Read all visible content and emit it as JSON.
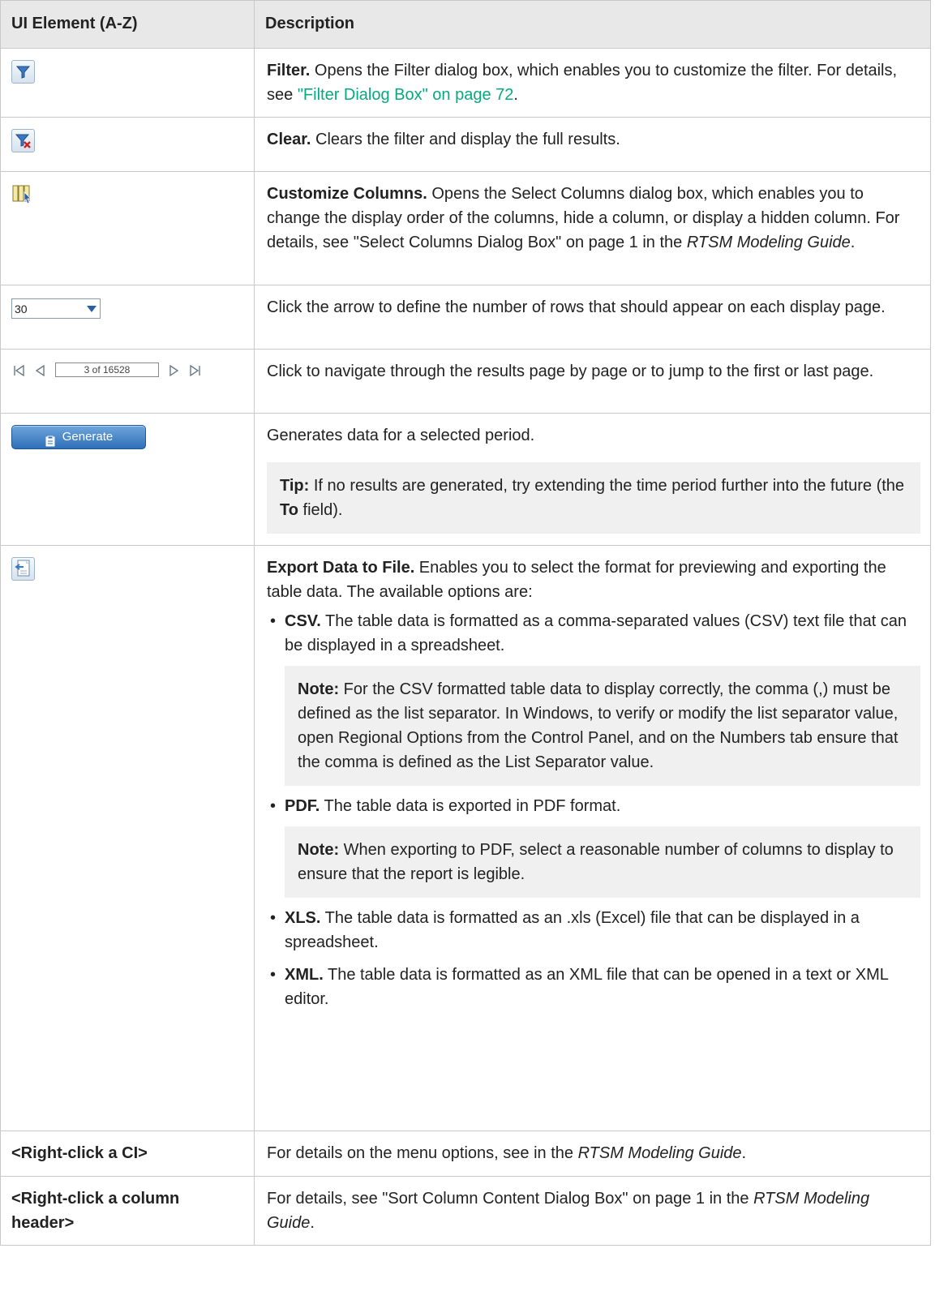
{
  "header": {
    "col1": "UI Element (A-Z)",
    "col2": "Description"
  },
  "rows": {
    "filter": {
      "icon": "filter-icon",
      "term": "Filter.",
      "text": " Opens the Filter dialog box, which enables you to customize the filter. For details, see ",
      "link": "\"Filter Dialog Box\" on page 72",
      "tail": "."
    },
    "clear": {
      "icon": "clear-filter-icon",
      "term": "Clear.",
      "text": " Clears the filter and display the full results."
    },
    "customize": {
      "icon": "customize-columns-icon",
      "term": "Customize Columns.",
      "text": " Opens the Select Columns dialog box, which enables you to change the display order of the columns, hide a column, or display a hidden column. For details, see \"Select Columns Dialog Box\" on page 1 in the ",
      "guide": "RTSM Modeling Guide",
      "tail": "."
    },
    "rows_per_page": {
      "value": "30",
      "text": "Click the arrow to define the number of rows that should appear on each display page."
    },
    "pager": {
      "value": "3 of 16528",
      "text": "Click to navigate through the results page by page or to jump to the first or last page."
    },
    "generate": {
      "button_label": "Generate",
      "text": "Generates data for a selected period.",
      "tip_label": "Tip:",
      "tip_text": " If no results are generated, try extending the time period further into the future (the ",
      "tip_field": "To",
      "tip_tail": " field)."
    },
    "export": {
      "icon": "export-data-icon",
      "term": "Export Data to File.",
      "text": " Enables you to select the format for previewing and exporting the table data. The available options are:",
      "csv_term": "CSV.",
      "csv_text": " The table data is formatted as a comma-separated values (CSV) text file that can be displayed in a spreadsheet.",
      "csv_note_label": "Note:",
      "csv_note_text": " For the CSV formatted table data to display correctly, the comma (,) must be defined as the list separator. In Windows, to verify or modify the list separator value, open Regional Options from the Control Panel, and on the Numbers tab ensure that the comma is defined as the List Separator value.",
      "pdf_term": "PDF.",
      "pdf_text": " The table data is exported in PDF format.",
      "pdf_note_label": "Note:",
      "pdf_note_text": " When exporting to PDF, select a reasonable number of columns to display to ensure that the report is legible.",
      "xls_term": "XLS.",
      "xls_text": " The table data is formatted as an .xls (Excel) file that can be displayed in a spreadsheet.",
      "xml_term": "XML.",
      "xml_text": " The table data is formatted as an XML file that can be opened in a text or XML editor."
    },
    "right_click_ci": {
      "element": "<Right-click a CI>",
      "text": "For details on the menu options, see  in the ",
      "guide": "RTSM Modeling Guide",
      "tail": "."
    },
    "right_click_header": {
      "element": "<Right-click a column header>",
      "text": "For details, see \"Sort Column Content Dialog Box\" on page 1 in the ",
      "guide": "RTSM Modeling Guide",
      "tail": "."
    }
  },
  "colors": {
    "link": "#0aa880",
    "header_bg": "#e8e8e8",
    "note_bg": "#f0f0f0",
    "border": "#c8c8c8",
    "generate_button": "#2e6fb8"
  }
}
